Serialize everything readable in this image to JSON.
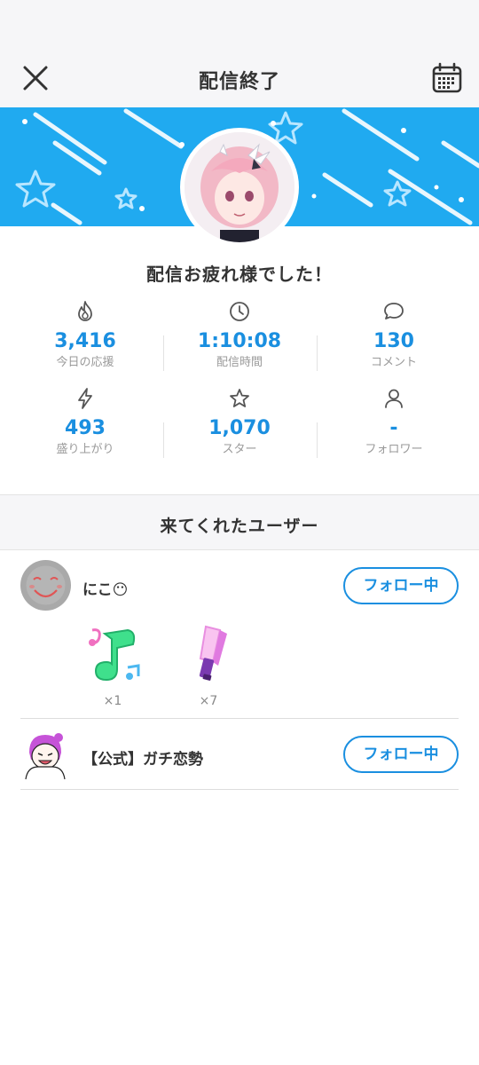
{
  "header": {
    "title": "配信終了",
    "close_icon": "close-icon",
    "calendar_icon": "calendar-icon"
  },
  "colors": {
    "accent": "#1a8fe0",
    "banner": "#20aaf0",
    "text": "#333333",
    "muted": "#9a9a9a"
  },
  "summary": {
    "message": "配信お疲れ様でした！"
  },
  "stats": [
    {
      "icon": "flame-icon",
      "value": "3,416",
      "label": "今日の応援"
    },
    {
      "icon": "clock-icon",
      "value": "1:10:08",
      "label": "配信時間"
    },
    {
      "icon": "comment-icon",
      "value": "130",
      "label": "コメント"
    },
    {
      "icon": "lightning-icon",
      "value": "493",
      "label": "盛り上がり"
    },
    {
      "icon": "star-icon",
      "value": "1,070",
      "label": "スター"
    },
    {
      "icon": "user-icon",
      "value": "-",
      "label": "フォロワー"
    }
  ],
  "visitors": {
    "title": "来てくれたユーザー",
    "users": [
      {
        "name": "にこ😶",
        "follow_label": "フォロー中",
        "gifts": [
          {
            "icon": "music-note-gift-icon",
            "count": "×1"
          },
          {
            "icon": "glow-stick-gift-icon",
            "count": "×7"
          }
        ]
      },
      {
        "name": "【公式】ガチ恋勢",
        "follow_label": "フォロー中",
        "gifts": []
      }
    ]
  }
}
